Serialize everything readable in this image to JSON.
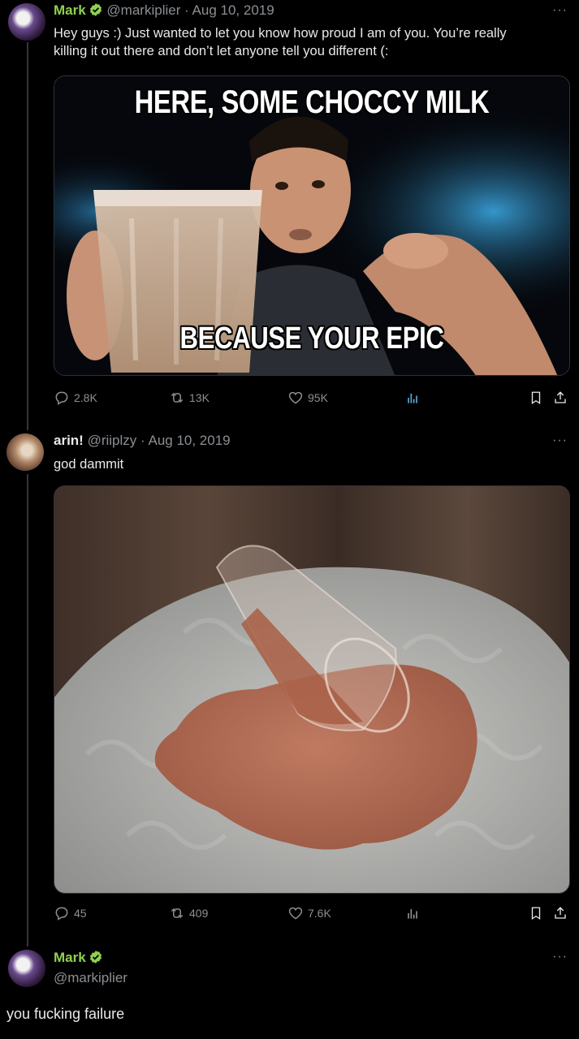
{
  "tweet1": {
    "name": "Mark",
    "handle": "@markiplier",
    "date": "· Aug 10, 2019",
    "text_line1": "Hey guys :) Just wanted to let you know how proud I am of you. You’re really",
    "text_line2": "killing it out there and don’t let anyone tell you different (:",
    "meme_top": "HERE, SOME CHOCCY MILK",
    "meme_bottom": "BECAUSE YOUR EPIC",
    "stats": {
      "replies": "2.8K",
      "retweets": "13K",
      "likes": "95K"
    }
  },
  "tweet2": {
    "name": "arin!",
    "handle": "@riiplzy",
    "date": "· Aug 10, 2019",
    "text": "god dammit",
    "stats": {
      "replies": "45",
      "retweets": "409",
      "likes": "7.6K"
    }
  },
  "tweet3": {
    "name": "Mark",
    "handle": "@markiplier",
    "text": "you fucking failure"
  },
  "more_label": "···",
  "colors": {
    "background": "#000000",
    "name_green": "#8fd14f",
    "muted": "#8b8f93",
    "text": "#e7e9ea"
  },
  "icons": [
    "reply-icon",
    "retweet-icon",
    "like-icon",
    "views-icon",
    "bookmark-icon",
    "share-icon",
    "verified-badge-icon",
    "more-icon"
  ]
}
